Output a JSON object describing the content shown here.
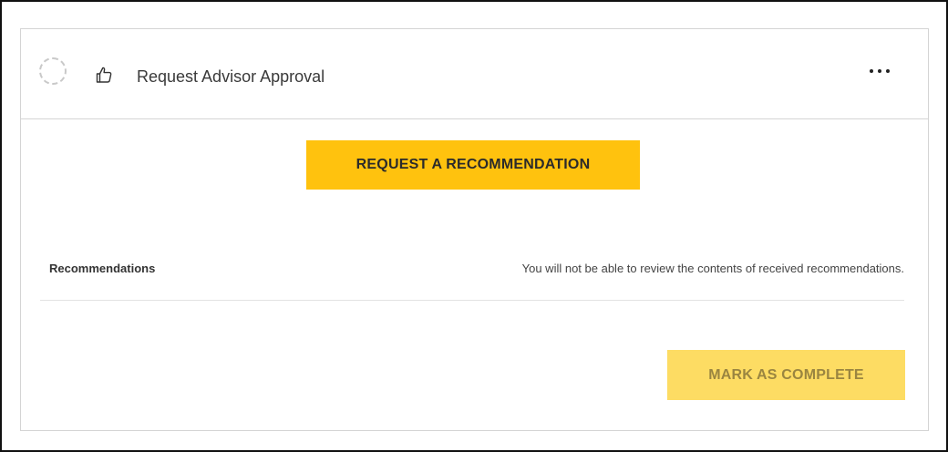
{
  "task": {
    "title": "Request Advisor Approval",
    "status": "incomplete",
    "icon": "thumbs-up-icon",
    "more_icon": "more-horizontal-icon"
  },
  "actions": {
    "request_label": "REQUEST A RECOMMENDATION",
    "complete_label": "MARK AS COMPLETE"
  },
  "recommendations": {
    "label": "Recommendations",
    "note": "You will not be able to review the contents of received recommendations."
  },
  "colors": {
    "primary_button": "#ffc20e",
    "disabled_button": "#fddc63",
    "border": "#d4d4d4"
  }
}
